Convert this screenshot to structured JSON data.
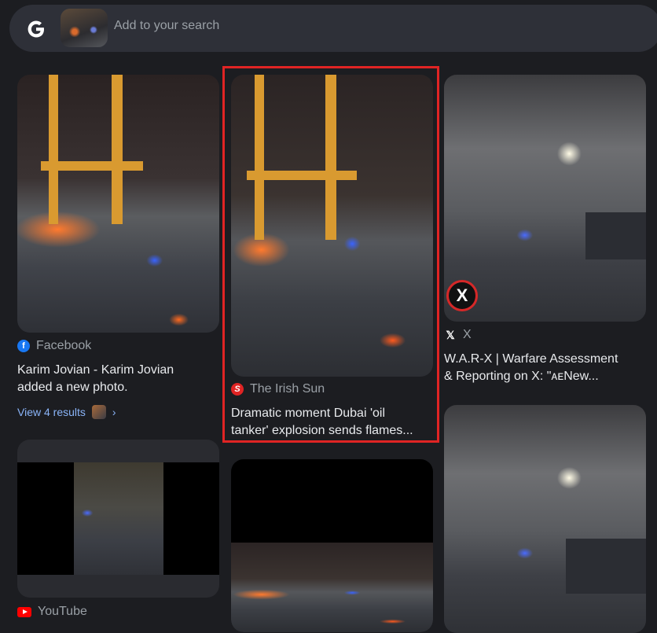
{
  "search": {
    "placeholder": "Add to your search",
    "logo_icon": "google-g-icon"
  },
  "results": [
    {
      "source": "Facebook",
      "source_icon": "facebook-icon",
      "title_line1": "Karim Jovian - Karim Jovian",
      "title_line2": "added a new photo.",
      "view_results": "View 4 results",
      "chevron": "›"
    },
    {
      "source": "The Irish Sun",
      "source_icon": "irish-sun-icon",
      "title_line1": "Dramatic moment Dubai 'oil",
      "title_line2": "tanker' explosion sends flames...",
      "highlighted": true,
      "highlight_color": "#e02424"
    },
    {
      "source": "X",
      "source_icon": "x-icon",
      "badge": "X",
      "title_line1": "W.A.R-X | Warfare Assessment",
      "title_line2": "& Reporting on X: \"ᴀᴇNew..."
    },
    {
      "source": "YouTube",
      "source_icon": "youtube-icon"
    }
  ],
  "colors": {
    "background": "#1c1d21",
    "link": "#8ab4f8",
    "highlight": "#e02424"
  }
}
